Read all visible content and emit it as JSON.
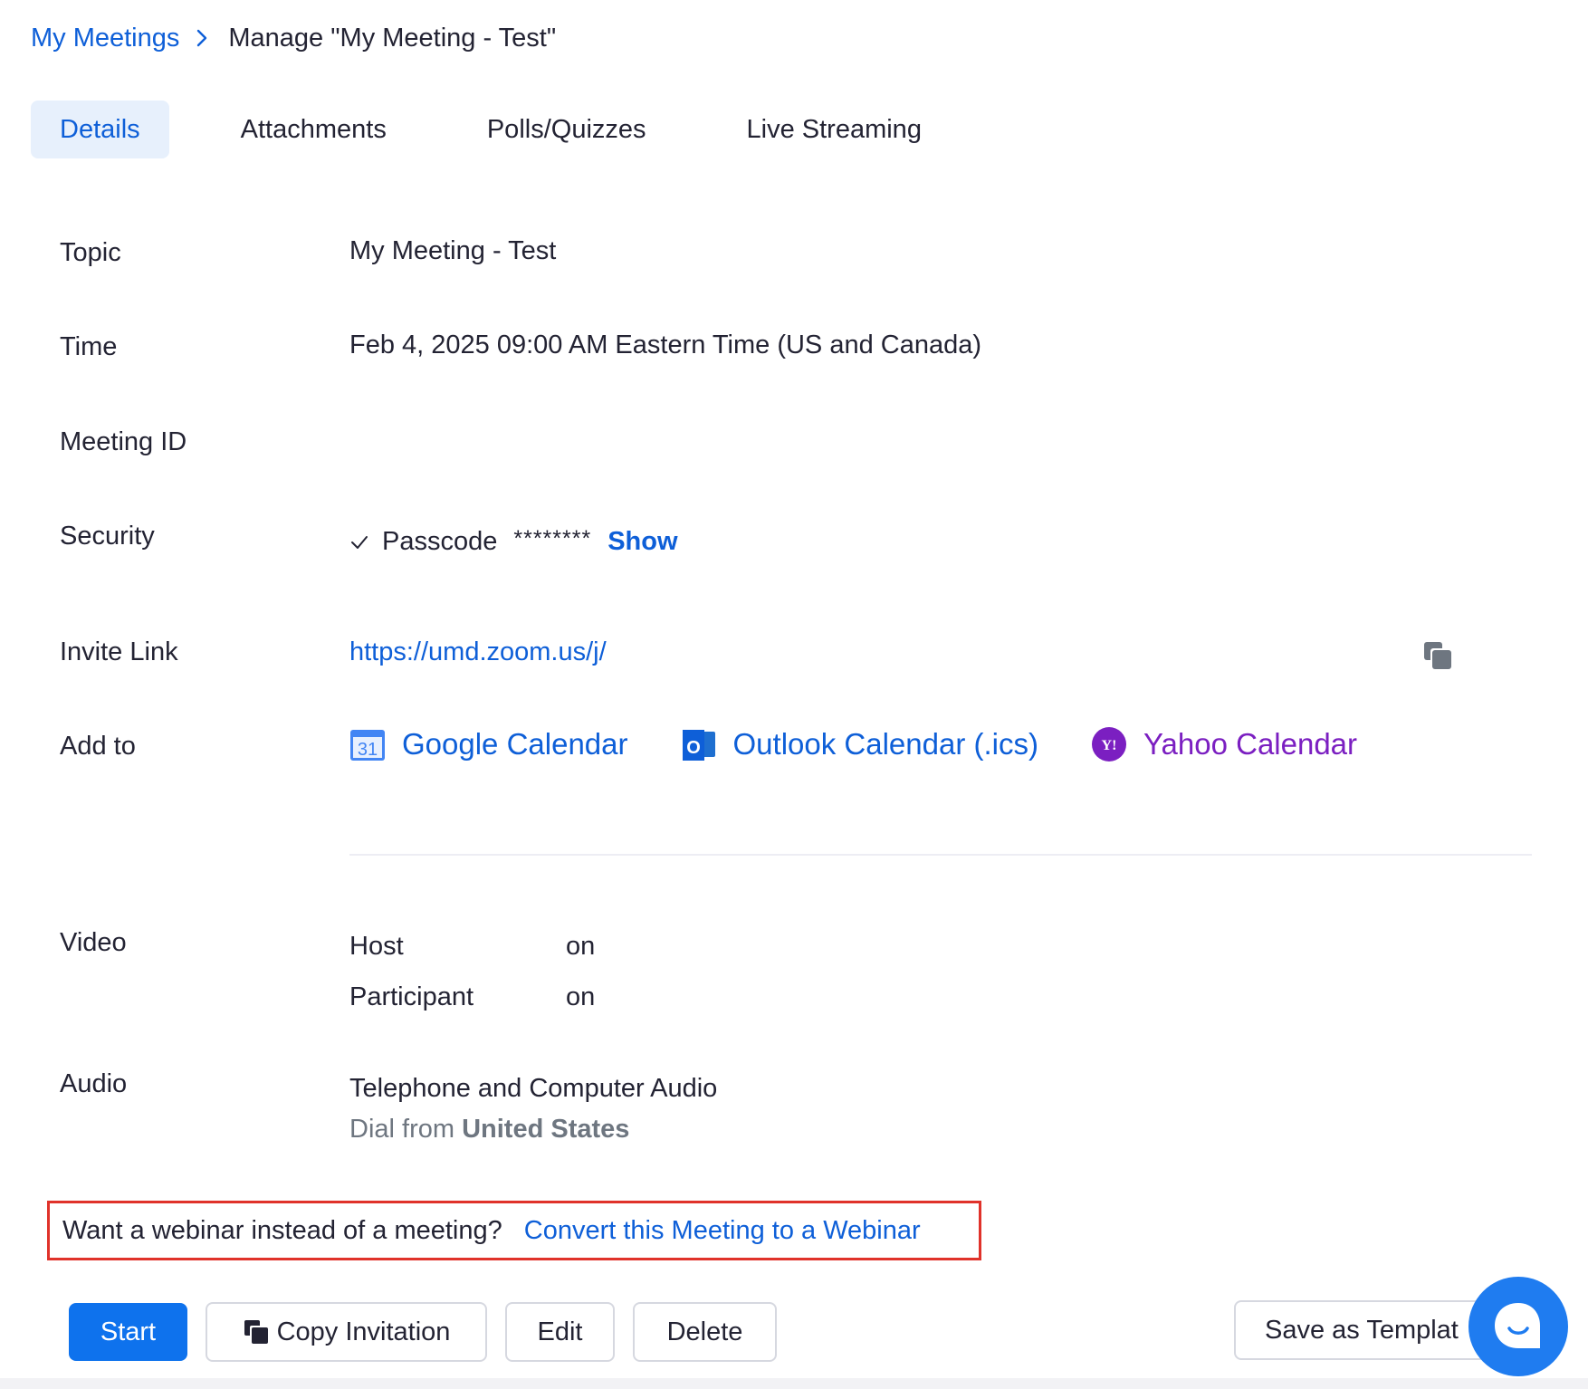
{
  "breadcrumb": {
    "parent": "My Meetings",
    "current": "Manage \"My Meeting - Test\""
  },
  "tabs": [
    {
      "label": "Details",
      "active": true
    },
    {
      "label": "Attachments",
      "active": false
    },
    {
      "label": "Polls/Quizzes",
      "active": false
    },
    {
      "label": "Live Streaming",
      "active": false
    }
  ],
  "details": {
    "topic": {
      "label": "Topic",
      "value": "My Meeting - Test"
    },
    "time": {
      "label": "Time",
      "value": "Feb 4, 2025 09:00 AM Eastern Time (US and Canada)"
    },
    "meeting_id": {
      "label": "Meeting ID",
      "value": ""
    },
    "security": {
      "label": "Security",
      "passcode_label": "Passcode",
      "passcode_mask": "********",
      "show_label": "Show"
    },
    "invite_link": {
      "label": "Invite Link",
      "url": "https://umd.zoom.us/j/"
    },
    "add_to": {
      "label": "Add to",
      "google": {
        "label": "Google Calendar",
        "icon_text": "31"
      },
      "outlook": {
        "label": "Outlook Calendar (.ics)",
        "icon_text": "O"
      },
      "yahoo": {
        "label": "Yahoo Calendar",
        "icon_text": "Y!"
      }
    },
    "video": {
      "label": "Video",
      "host_label": "Host",
      "host_value": "on",
      "participant_label": "Participant",
      "participant_value": "on"
    },
    "audio": {
      "label": "Audio",
      "value": "Telephone and Computer Audio",
      "dial_prefix": "Dial from",
      "dial_country": "United States"
    }
  },
  "webinar": {
    "question": "Want a webinar instead of a meeting?",
    "link": "Convert this Meeting to a Webinar"
  },
  "actions": {
    "start": "Start",
    "copy_invitation": "Copy Invitation",
    "edit": "Edit",
    "delete": "Delete",
    "save_template": "Save as Templat"
  },
  "colors": {
    "accent": "#0e5fd8",
    "primary_button": "#0e72ed",
    "highlight_border": "#e0322a",
    "yahoo": "#7b1fc1",
    "chat": "#1f7cf0"
  },
  "icons": [
    "chevron-right-icon",
    "checkmark-icon",
    "copy-icon",
    "google-calendar-icon",
    "outlook-icon",
    "yahoo-icon",
    "chat-icon"
  ]
}
